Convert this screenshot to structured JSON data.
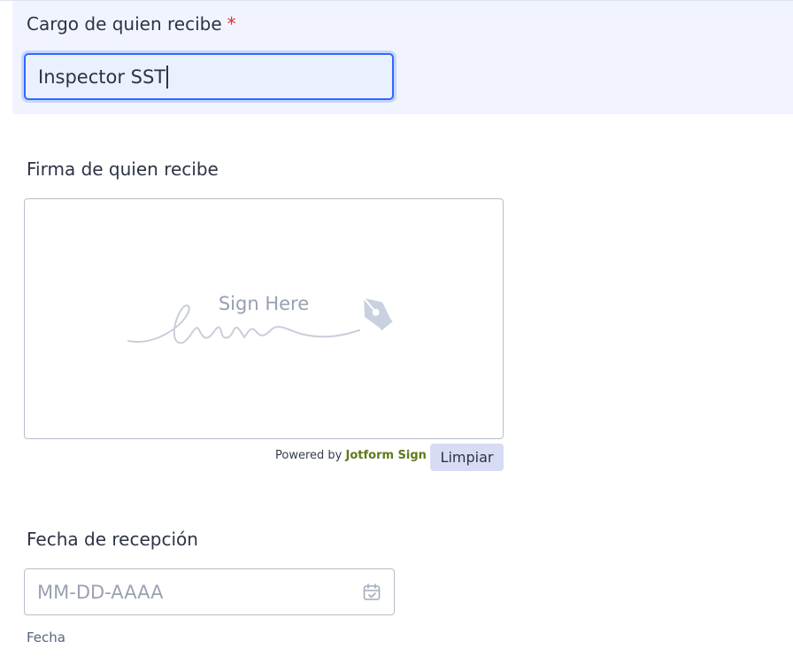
{
  "cargo_field": {
    "label": "Cargo de quien recibe",
    "required_mark": "*",
    "value": "Inspector SST"
  },
  "signature_field": {
    "label": "Firma de quien recibe",
    "placeholder": "Sign Here",
    "powered_by_prefix": "Powered by",
    "powered_by_brand": "Jotform Sign",
    "clear_label": "Limpiar"
  },
  "date_field": {
    "label": "Fecha de recepción",
    "placeholder": "MM-DD-AAAA",
    "sublabel": "Fecha"
  }
}
